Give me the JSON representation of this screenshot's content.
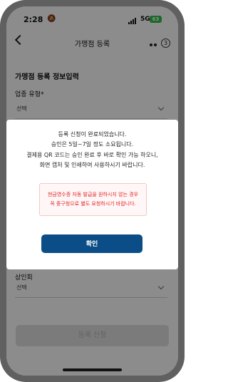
{
  "status_bar": {
    "time": "2:28",
    "extra": "🔕",
    "network": "5G",
    "battery": "63"
  },
  "header": {
    "title": "가맹점 등록",
    "step": "3"
  },
  "form": {
    "section_title": "가맹점 등록 정보입력",
    "business_type_label": "업종 유형*",
    "business_type_value": "선택",
    "bank_label": "상인회",
    "bank_value": "선택",
    "submit_label": "등록 신청"
  },
  "dialog": {
    "lines": [
      "등록 신청이 완료되었습니다.",
      "승인은 5일~7일 정도 소요됩니다.",
      "결제용 QR 코드는 승인 완료 후 바로 확인 가능 하오니,",
      "화면 캡처 및 인쇄하여 사용하시기 바랍니다."
    ],
    "notice_lines": [
      "현금영수증 자동 발급을 원하시지 않는 경우",
      "꼭 중구청으로 별도 요청하시기 바랍니다."
    ],
    "confirm_label": "확인"
  },
  "colors": {
    "confirm_button": "#0b4d86",
    "notice_text": "#e02020",
    "battery": "#2fbf4a"
  }
}
